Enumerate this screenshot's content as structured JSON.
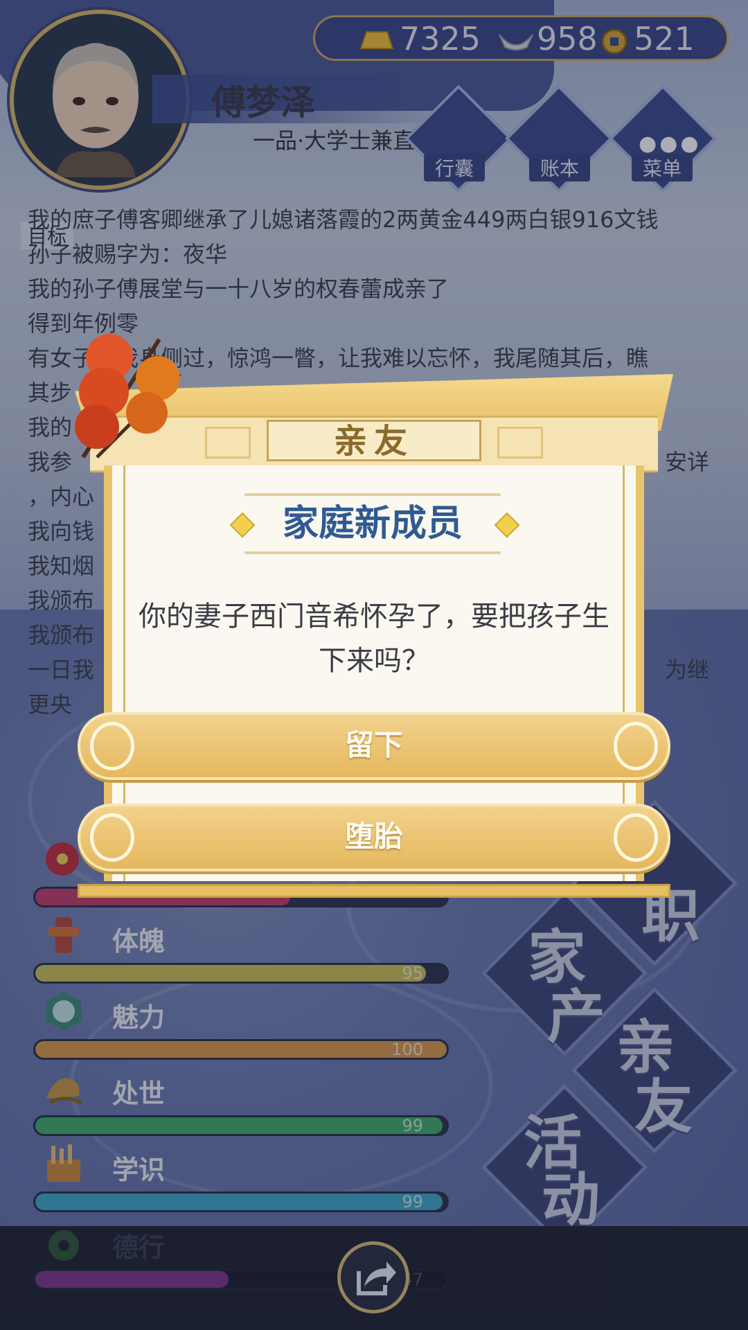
{
  "player": {
    "name": "傅梦泽",
    "rank": "一品·大学士兼直"
  },
  "currency": {
    "gold": "7325",
    "silver": "958",
    "coins": "521"
  },
  "menu": {
    "bag": "行囊",
    "ledger": "账本",
    "menu": "菜单",
    "goal": "目标"
  },
  "log": [
    "我的庶子傅客卿继承了儿媳诸落霞的2两黄金449两白银916文钱",
    "孙子被赐字为：夜华",
    "我的孙子傅展堂与一十八岁的权春蕾成亲了",
    "得到年例零",
    "有女子从我身侧过，惊鸿一瞥，让我难以忘怀，我尾随其后，瞧",
    "其步",
    "我的",
    "我参",
    "，内心",
    "我向钱",
    "我知烟",
    "我颁布",
    "我颁布",
    "一日我",
    "更央"
  ],
  "log_fragments_right": {
    "row8": "安详",
    "row14": "为继"
  },
  "stats": [
    {
      "name": "",
      "value": "",
      "level": 0.62,
      "color": "#c2406e"
    },
    {
      "name": "体魄",
      "value": "95",
      "level": 0.95,
      "color": "#c9c05a"
    },
    {
      "name": "魅力",
      "value": "100",
      "level": 1.0,
      "color": "#d79b4a"
    },
    {
      "name": "处世",
      "value": "99",
      "level": 0.99,
      "color": "#3fae6a"
    },
    {
      "name": "学识",
      "value": "99",
      "level": 0.99,
      "color": "#3fa8c9"
    },
    {
      "name": "德行",
      "value": "47",
      "level": 0.47,
      "color": "#7a3a8c"
    }
  ],
  "side_actions": {
    "official": "职",
    "estate_1": "家",
    "estate_2": "产",
    "family_1": "亲",
    "family_2": "友",
    "activity_1": "活",
    "activity_2": "动"
  },
  "dialog": {
    "category": "亲友",
    "title": "家庭新成员",
    "message": "你的妻子西门音希怀孕了，要把孩子生下来吗？",
    "choice_keep": "留下",
    "choice_abort": "堕胎"
  },
  "colors": {
    "accent_gold": "#e8c066",
    "title_blue": "#2f5a93",
    "panel_navy": "#3b4c8e"
  }
}
